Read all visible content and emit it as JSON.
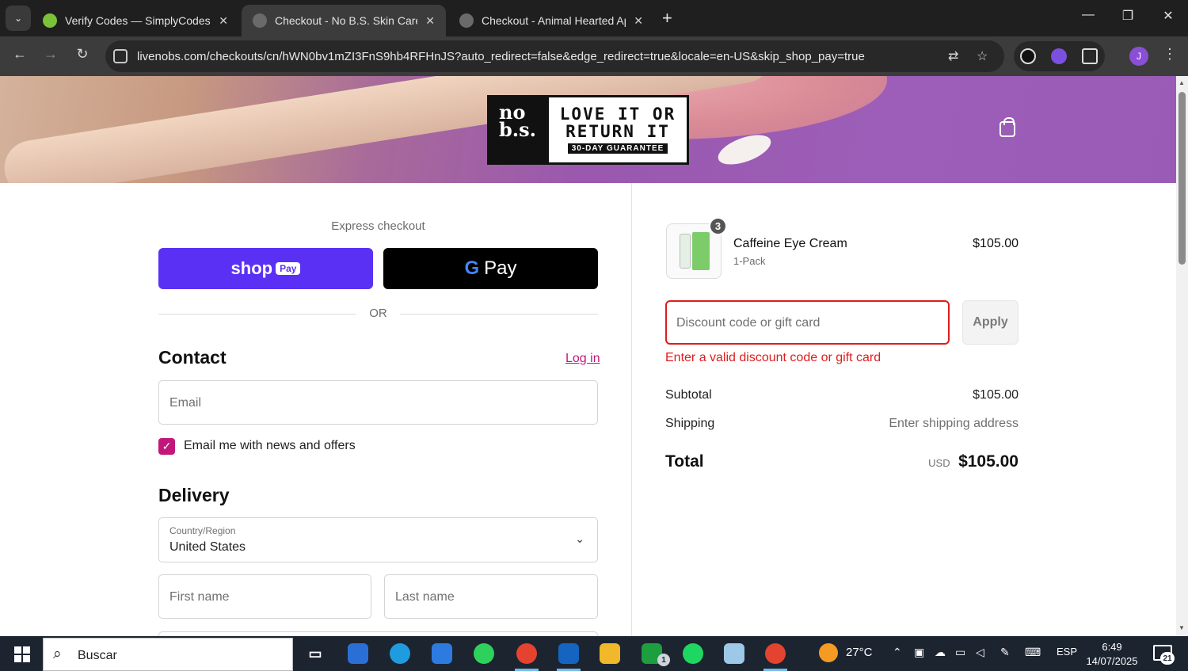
{
  "browser": {
    "tabs": [
      {
        "label": "Verify Codes — SimplyCodes",
        "favicon_color": "#7cc13a",
        "active": false
      },
      {
        "label": "Checkout - No B.S. Skin Care",
        "favicon_color": "#7a7a7a",
        "active": true
      },
      {
        "label": "Checkout - Animal Hearted App",
        "favicon_color": "#7a7a7a",
        "active": false
      }
    ],
    "new_tab_symbol": "+",
    "close_symbol": "✕",
    "url": "livenobs.com/checkouts/cn/hWN0bv1mZI3FnS9hb4RFHnJS?auto_redirect=false&edge_redirect=true&locale=en-US&skip_shop_pay=true",
    "profile_initial": "J"
  },
  "brand": {
    "logo_left": "no b.s.",
    "logo_line1": "LOVE IT OR",
    "logo_line2": "RETURN IT",
    "logo_sub": "30-DAY GUARANTEE"
  },
  "checkout": {
    "express_label": "Express checkout",
    "shop_pay": {
      "main": "shop",
      "badge": "Pay"
    },
    "gpay": {
      "g": "G",
      "pay": "Pay"
    },
    "or_label": "OR",
    "contact_heading": "Contact",
    "login_link": "Log in",
    "email_placeholder": "Email",
    "newsletter_label": "Email me with news and offers",
    "newsletter_checked": true,
    "delivery_heading": "Delivery",
    "country_label": "Country/Region",
    "country_value": "United States",
    "first_name_placeholder": "First name",
    "last_name_placeholder": "Last name"
  },
  "summary": {
    "product": {
      "name": "Caffeine Eye Cream",
      "variant": "1-Pack",
      "price": "$105.00",
      "quantity": "3"
    },
    "discount_placeholder": "Discount code or gift card",
    "apply_label": "Apply",
    "error_text": "Enter a valid discount code or gift card",
    "subtotal_label": "Subtotal",
    "subtotal_value": "$105.00",
    "shipping_label": "Shipping",
    "shipping_value": "Enter shipping address",
    "total_label": "Total",
    "currency": "USD",
    "total_value": "$105.00"
  },
  "colors": {
    "accent": "#c2177a",
    "error": "#dd1d1d",
    "shop_pay": "#5a31f4"
  },
  "taskbar": {
    "search_text": "Buscar",
    "weather": "27°C",
    "language": "ESP",
    "time": "6:49",
    "date": "14/07/2025",
    "notification_count": "21",
    "xbox_badge": "1"
  }
}
